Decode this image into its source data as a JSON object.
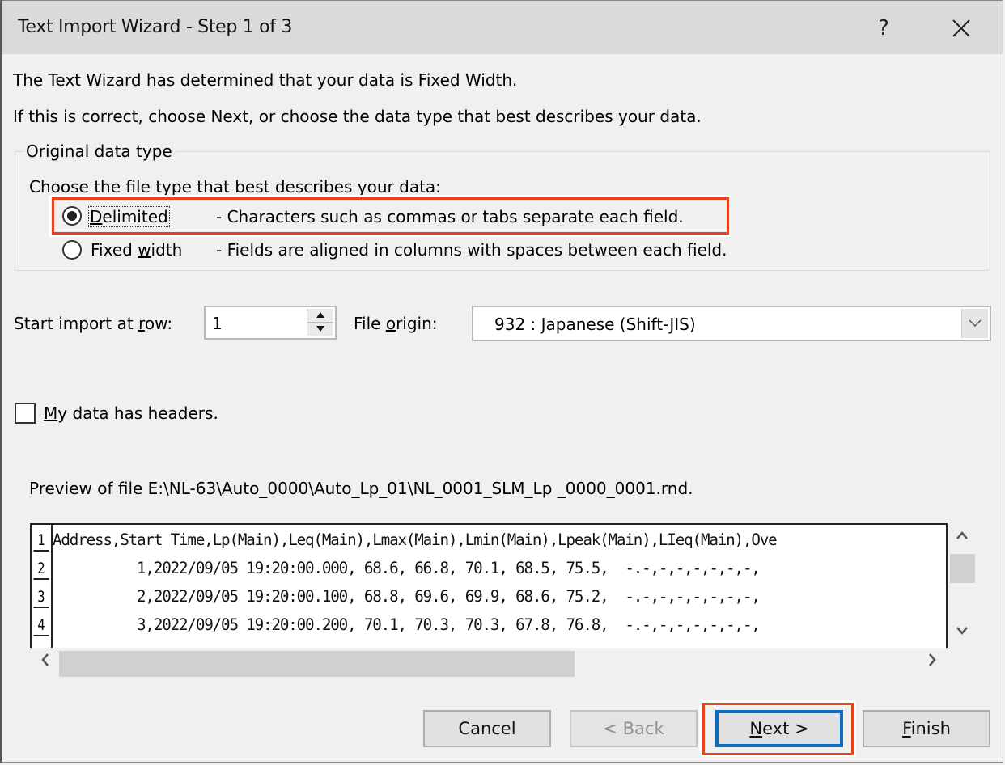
{
  "window": {
    "title": "Text Import Wizard - Step 1 of 3",
    "help_glyph": "?",
    "close_glyph": "close-icon"
  },
  "intro": {
    "line1": "The Text Wizard has determined that your data is Fixed Width.",
    "line2": "If this is correct, choose Next, or choose the data type that best describes your data."
  },
  "original_data_type": {
    "legend": "Original data type",
    "prompt": "Choose the file type that best describes your data:",
    "options": [
      {
        "label_prefix": "",
        "label_underline": "D",
        "label_rest": "elimited",
        "description": "- Characters such as commas or tabs separate each field.",
        "selected": true,
        "highlighted": true
      },
      {
        "label_prefix": "Fixed ",
        "label_underline": "w",
        "label_rest": "idth",
        "description": "- Fields are aligned in columns with spaces between each field.",
        "selected": false,
        "highlighted": false
      }
    ]
  },
  "start_row": {
    "label_prefix": "Start import at ",
    "label_underline": "r",
    "label_rest": "ow:",
    "value": "1"
  },
  "file_origin": {
    "label_prefix": "File ",
    "label_underline": "o",
    "label_rest": "rigin:",
    "value": "932 : Japanese (Shift-JIS)"
  },
  "headers_checkbox": {
    "label_underline": "M",
    "label_rest": "y data has headers.",
    "checked": false
  },
  "preview": {
    "caption": "Preview of file E:\\NL-63\\Auto_0000\\Auto_Lp_01\\NL_0001_SLM_Lp _0000_0001.rnd.",
    "rows": [
      {
        "num": "1",
        "text": "Address,Start Time,Lp(Main),Leq(Main),Lmax(Main),Lmin(Main),Lpeak(Main),LIeq(Main),Ove"
      },
      {
        "num": "2",
        "text": "          1,2022/09/05 19:20:00.000, 68.6, 66.8, 70.1, 68.5, 75.5,  -.-,-,-,-,-,-,-,"
      },
      {
        "num": "3",
        "text": "          2,2022/09/05 19:20:00.100, 68.8, 69.6, 69.9, 68.6, 75.2,  -.-,-,-,-,-,-,-,"
      },
      {
        "num": "4",
        "text": "          3,2022/09/05 19:20:00.200, 70.1, 70.3, 70.3, 67.8, 76.8,  -.-,-,-,-,-,-,-,"
      }
    ],
    "hscroll_thumb_fraction": 0.6
  },
  "buttons": {
    "cancel": "Cancel",
    "back": "< Back",
    "next_underline": "N",
    "next_rest": "ext >",
    "finish_underline": "F",
    "finish_rest": "inish"
  },
  "colors": {
    "highlight": "#e8421a",
    "default_button": "#0e6bc0"
  }
}
